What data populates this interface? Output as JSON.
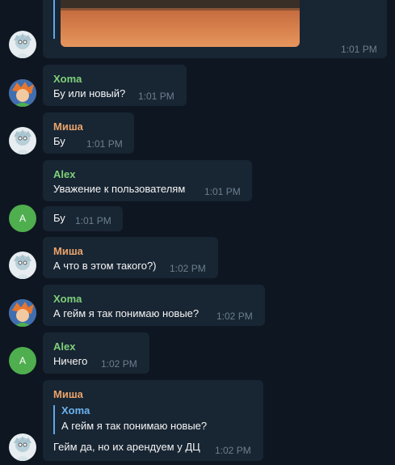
{
  "colors": {
    "background": "#0e1621",
    "bubble": "#182533",
    "name_green": "#7fd17a",
    "name_orange": "#e8a36b",
    "reply_blue": "#6bb3f0",
    "time": "#6d7f8f"
  },
  "top_message": {
    "time": "1:01 PM"
  },
  "messages": [
    {
      "author": "Xoma",
      "text": "Бу или новый?",
      "time": "1:01 PM"
    },
    {
      "author": "Миша",
      "text": "Бу",
      "time": "1:01 PM"
    },
    {
      "author": "Alex",
      "text": "Уважение к пользователям",
      "time": "1:01 PM"
    },
    {
      "text": "Бу",
      "time": "1:01 PM"
    },
    {
      "author": "Миша",
      "text": "А что в этом такого?)",
      "time": "1:02 PM"
    },
    {
      "author": "Xoma",
      "text": "А гейм я так понимаю новые?",
      "time": "1:02 PM"
    },
    {
      "author": "Alex",
      "text": "Ничего",
      "time": "1:02 PM"
    },
    {
      "author": "Миша",
      "reply": {
        "author": "Xoma",
        "text": "А гейм я так понимаю новые?"
      },
      "text": "Гейм да, но их арендуем у ДЦ",
      "time": "1:02 PM"
    }
  ],
  "avatars": {
    "alex_initial": "A"
  },
  "icons": [
    "rick-avatar-icon",
    "xoma-avatar-icon"
  ]
}
